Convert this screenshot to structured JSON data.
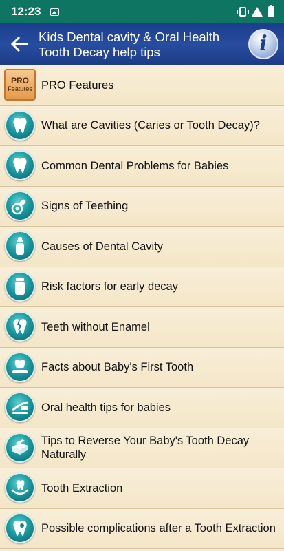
{
  "status_bar": {
    "time": "12:23"
  },
  "app_bar": {
    "title": "Kids Dental cavity & Oral Health Tooth Decay  help tips",
    "back_icon": "arrow-left-icon",
    "info_glyph": "i"
  },
  "pro_item": {
    "line1": "PRO",
    "line2": "Features",
    "label": "PRO Features"
  },
  "items": [
    {
      "label": "What are Cavities (Caries or Tooth Decay)?"
    },
    {
      "label": "Common Dental Problems for Babies"
    },
    {
      "label": "Signs of Teething"
    },
    {
      "label": "Causes of Dental Cavity"
    },
    {
      "label": "Risk factors for early decay"
    },
    {
      "label": "Teeth without Enamel"
    },
    {
      "label": "Facts about Baby's First Tooth"
    },
    {
      "label": "Oral health tips for babies"
    },
    {
      "label": "Tips to Reverse Your Baby's Tooth Decay Naturally"
    },
    {
      "label": "Tooth Extraction"
    },
    {
      "label": "Possible complications after a Tooth Extraction"
    }
  ],
  "colors": {
    "status_bar": "#0d7561",
    "app_bar": "#274d9e",
    "list_bg": "#f7ecd3",
    "icon_teal": "#1b9ba0"
  }
}
